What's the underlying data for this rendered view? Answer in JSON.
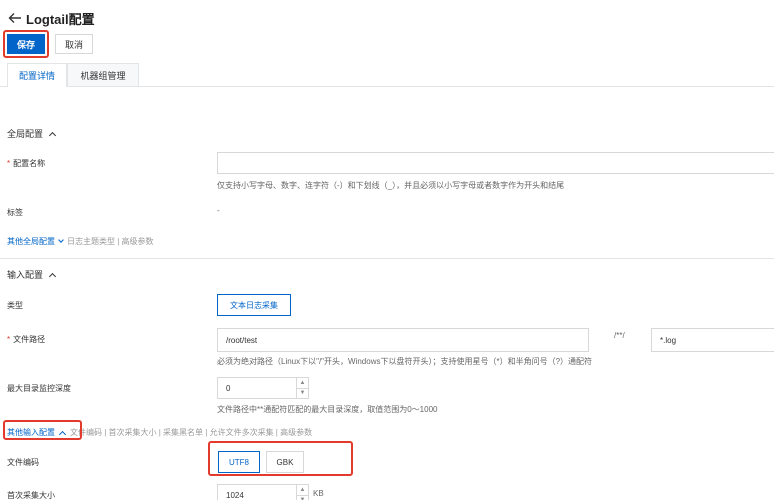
{
  "header": {
    "title": "Logtail配置"
  },
  "toolbar": {
    "save_label": "保存",
    "cancel_label": "取消"
  },
  "tabs": [
    {
      "label": "配置详情",
      "active": true
    },
    {
      "label": "机器组管理",
      "active": false
    }
  ],
  "global_section": {
    "title": "全局配置",
    "config_name_label": "配置名称",
    "config_name_value": "",
    "config_name_hint": "仅支持小写字母、数字、连字符（-）和下划线（_），并且必须以小写字母或者数字作为开头和结尾",
    "tags_label": "标签",
    "tags_value": "-",
    "other_link": "其他全局配置",
    "other_items": "日志主题类型 | 高级参数"
  },
  "input_section": {
    "title": "输入配置",
    "type_label": "类型",
    "type_button": "文本日志采集",
    "path_label": "文件路径",
    "path_value": "/root/test",
    "path_sep": "/**/",
    "file_pattern": "*.log",
    "path_hint": "必须为绝对路径（Linux下以\"/\"开头，Windows下以盘符开头）；支持使用星号（*）和半角问号（?）通配符",
    "max_depth_label": "最大目录监控深度",
    "max_depth_value": "0",
    "max_depth_hint": "文件路径中**通配符匹配的最大目录深度，取值范围为0～1000",
    "other_link": "其他输入配置",
    "other_items": "文件编码 | 首次采集大小 | 采集黑名单 | 允许文件多次采集 | 高级参数",
    "encoding_label": "文件编码",
    "encoding_options": [
      "UTF8",
      "GBK"
    ],
    "encoding_selected": "UTF8",
    "first_size_label": "首次采集大小",
    "first_size_value": "1024",
    "first_size_unit": "KB"
  },
  "colors": {
    "primary": "#0064c8",
    "highlight": "#e23b2e"
  },
  "icons": {
    "back": "arrow-left-icon"
  }
}
